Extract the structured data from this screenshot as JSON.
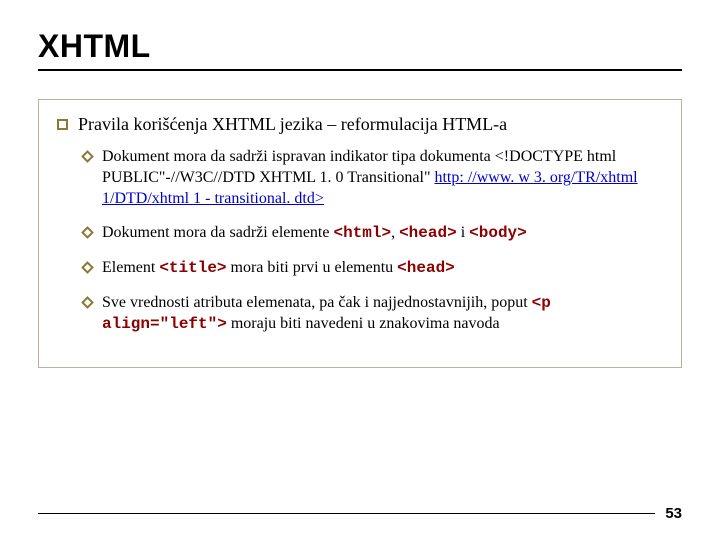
{
  "slide": {
    "title": "XHTML",
    "main": "Pravila korišćenja XHTML jezika – reformulacija HTML-a",
    "items": {
      "a_pre": "Dokument mora da sadrži ispravan indikator tipa dokumenta <!DOCTYPE html PUBLIC\"-//W3C//DTD XHTML 1. 0 Transitional\" ",
      "a_link1": "http: //www. w 3. org/TR/xhtml 1/DTD/xhtml 1 - transitional. dtd>",
      "b_pre": "Dokument mora da sadrži elemente ",
      "b_c1": "<html>",
      "b_mid1": ", ",
      "b_c2": "<head>",
      "b_mid2": " i ",
      "b_c3": "<body>",
      "c_pre": "Element ",
      "c_c1": "<title>",
      "c_mid": " mora biti prvi u elementu ",
      "c_c2": "<head>",
      "d_pre": "Sve vrednosti atributa elemenata, pa čak i najjednostavnijih, poput ",
      "d_c1": "<p align=\"left\">",
      "d_post": " moraju biti navedeni u znakovima navoda"
    },
    "page": "53"
  }
}
